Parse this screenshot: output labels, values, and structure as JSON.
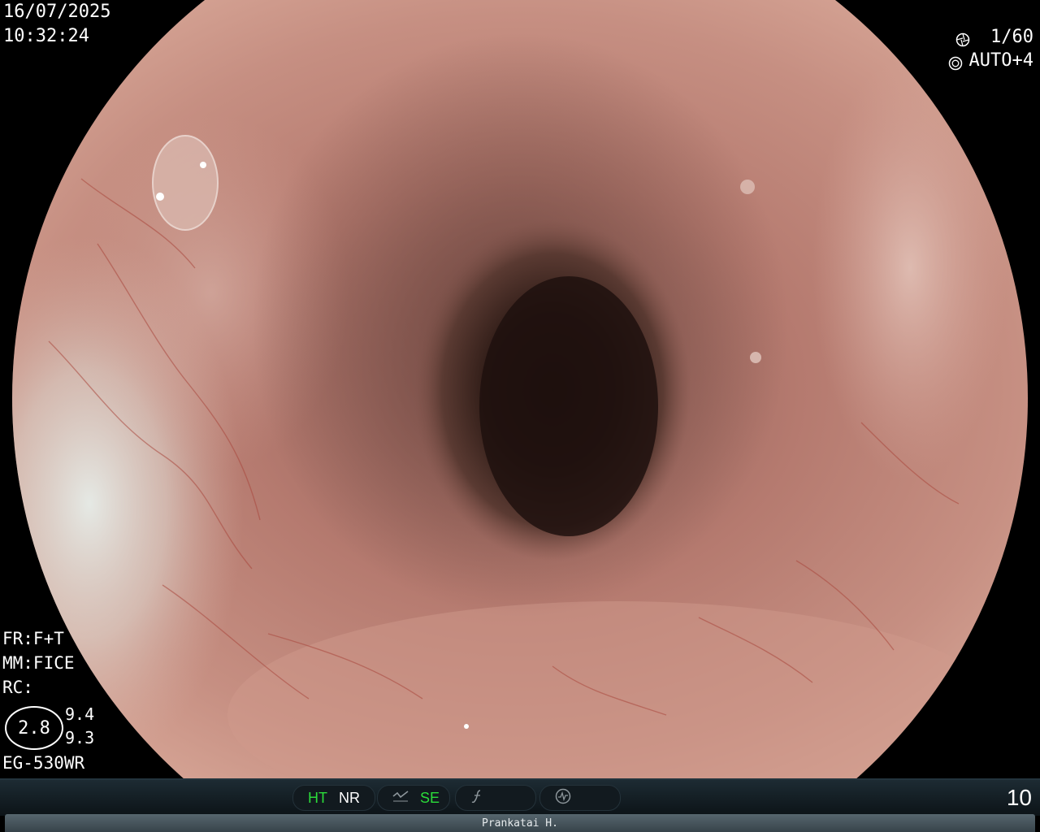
{
  "header": {
    "date": "16/07/2025",
    "time": "10:32:24"
  },
  "camera": {
    "shutter_icon": "aperture-icon",
    "shutter": "1/60",
    "iris_icon": "iris-icon",
    "iris": "AUTO+4"
  },
  "settings": {
    "fr": "FR:F+T",
    "mm": "MM:FICE",
    "rc": "RC:",
    "magnification": "2.8",
    "value_top": "9.4",
    "value_bottom": "9.3",
    "scope_model": "EG-530WR"
  },
  "statusbar": {
    "ht": "HT",
    "nr": "NR",
    "se": "SE",
    "page": "10",
    "colors": {
      "active": "#2bdc3a",
      "inactive": "#ffffff",
      "icon": "#8d969b"
    }
  },
  "patient": {
    "name": "Prankatai H."
  }
}
